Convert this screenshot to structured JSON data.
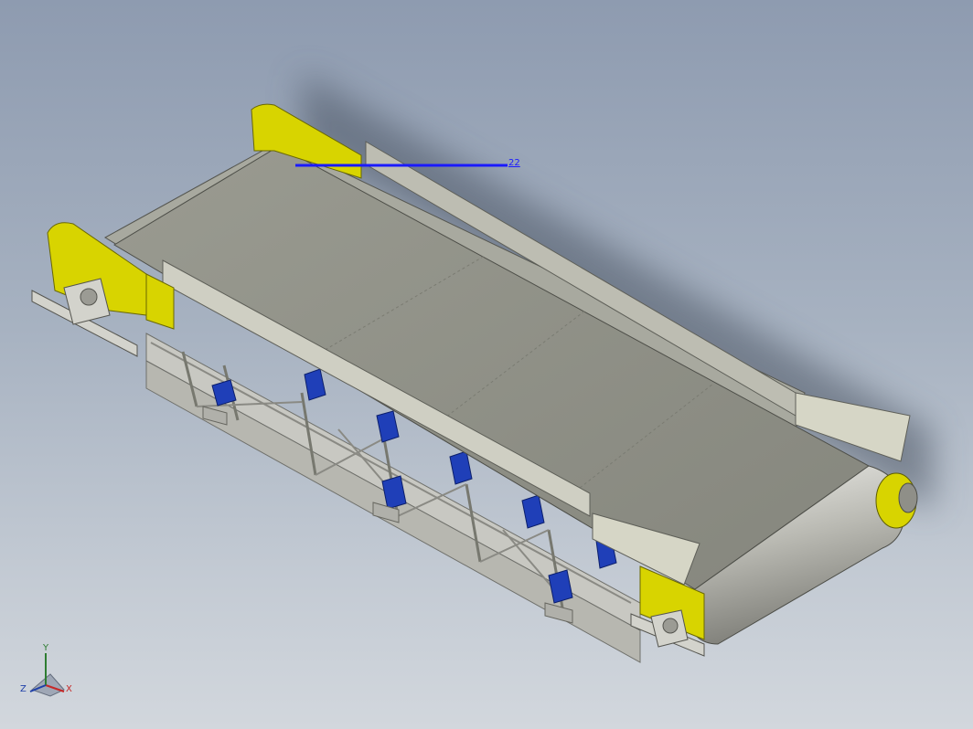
{
  "window": {
    "background": "#a3aebe"
  },
  "model": {
    "name": "belt-conveyor",
    "colors": {
      "belt": "#8f9086",
      "belt_side": "#a8a99f",
      "skirt": "#d6d6c6",
      "guard": "#d8d400",
      "frame": "#c5c5c0",
      "idler_bracket": "#1f3fb8",
      "pulley": "#c9c9c4"
    }
  },
  "dimension": {
    "label": "22",
    "color": "#1a1aff"
  },
  "triad": {
    "x_label": "X",
    "y_label": "Y",
    "z_label": "Z",
    "x_color": "#c62828",
    "y_color": "#2e7d32",
    "z_color": "#1e3fa8"
  }
}
